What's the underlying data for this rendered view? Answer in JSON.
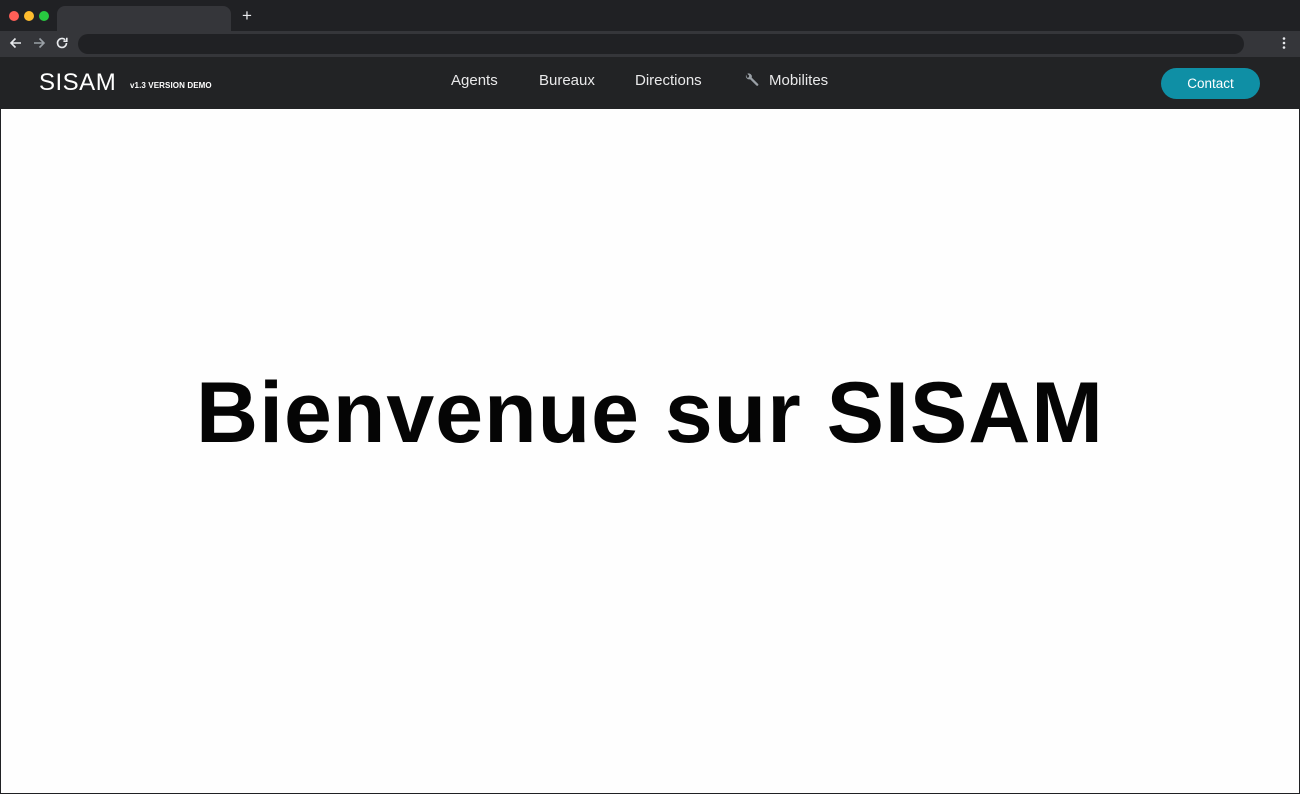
{
  "browser": {
    "new_tab_symbol": "+",
    "back_icon": "arrow-left",
    "forward_icon": "arrow-right",
    "reload_icon": "reload",
    "menu_icon": "kebab-menu"
  },
  "site": {
    "brand": "SISAM",
    "version": "v1.3 VERSION DEMO",
    "nav": {
      "agents": "Agents",
      "bureaux": "Bureaux",
      "directions": "Directions",
      "mobilites": "Mobilites",
      "mobilites_icon": "wrench-icon"
    },
    "contact_label": "Contact",
    "accent_color": "#0f8fa5"
  },
  "main": {
    "heading": "Bienvenue sur SISAM"
  }
}
